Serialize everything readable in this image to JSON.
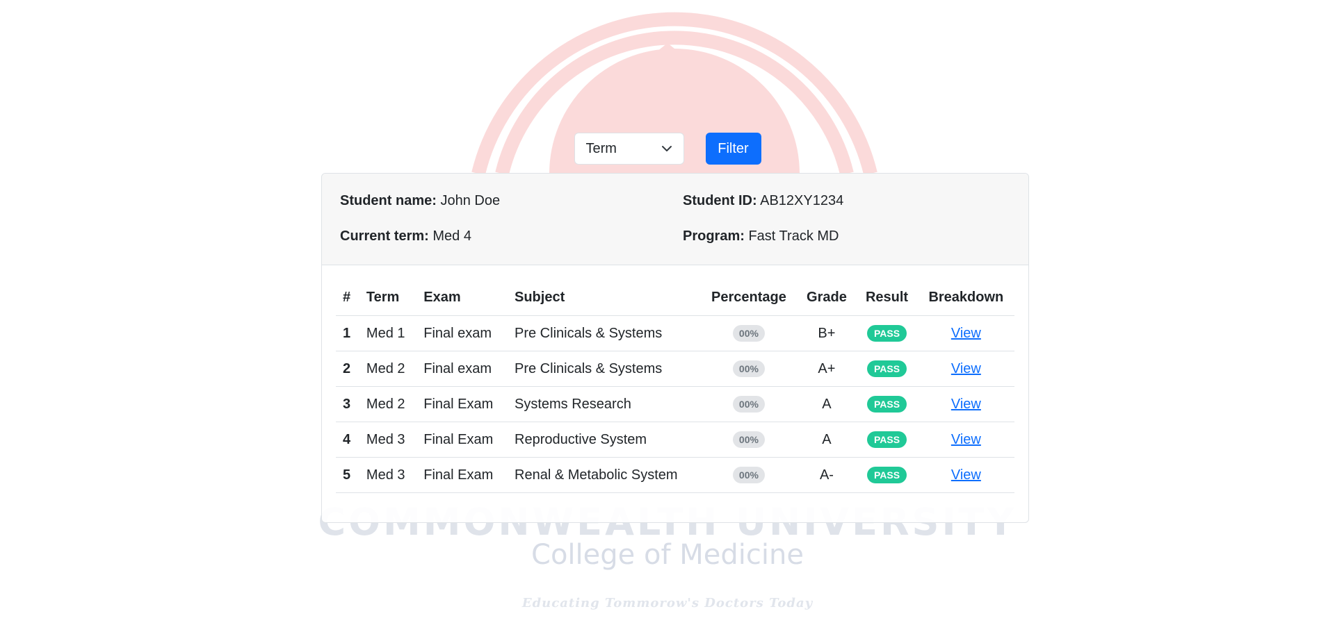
{
  "watermark": {
    "university": "COMMONWEALTH UNIVERSITY",
    "college": "College of Medicine",
    "motto": "Educating Tommorow's Doctors Today"
  },
  "filter": {
    "term_select_value": "Term",
    "filter_button": "Filter"
  },
  "student": {
    "name_label": "Student name:",
    "name": "John Doe",
    "id_label": "Student ID:",
    "id": "AB12XY1234",
    "term_label": "Current term:",
    "term": "Med 4",
    "program_label": "Program:",
    "program": "Fast Track MD"
  },
  "table": {
    "headers": [
      "#",
      "Term",
      "Exam",
      "Subject",
      "Percentage",
      "Grade",
      "Result",
      "Breakdown"
    ],
    "rows": [
      {
        "num": "1",
        "term": "Med 1",
        "exam": "Final exam",
        "subject": "Pre Clinicals & Systems",
        "percentage": "00%",
        "grade": "B+",
        "result": "PASS",
        "breakdown": "View"
      },
      {
        "num": "2",
        "term": "Med 2",
        "exam": "Final exam",
        "subject": "Pre Clinicals & Systems",
        "percentage": "00%",
        "grade": "A+",
        "result": "PASS",
        "breakdown": "View"
      },
      {
        "num": "3",
        "term": "Med 2",
        "exam": "Final Exam",
        "subject": "Systems Research",
        "percentage": "00%",
        "grade": "A",
        "result": "PASS",
        "breakdown": "View"
      },
      {
        "num": "4",
        "term": "Med 3",
        "exam": "Final Exam",
        "subject": "Reproductive System",
        "percentage": "00%",
        "grade": "A",
        "result": "PASS",
        "breakdown": "View"
      },
      {
        "num": "5",
        "term": "Med 3",
        "exam": "Final Exam",
        "subject": "Renal & Metabolic System",
        "percentage": "00%",
        "grade": "A-",
        "result": "PASS",
        "breakdown": "View"
      }
    ]
  },
  "colors": {
    "primary": "#0d6efd",
    "pass_badge": "#20c997",
    "watermark_red": "#f9d6d6"
  }
}
